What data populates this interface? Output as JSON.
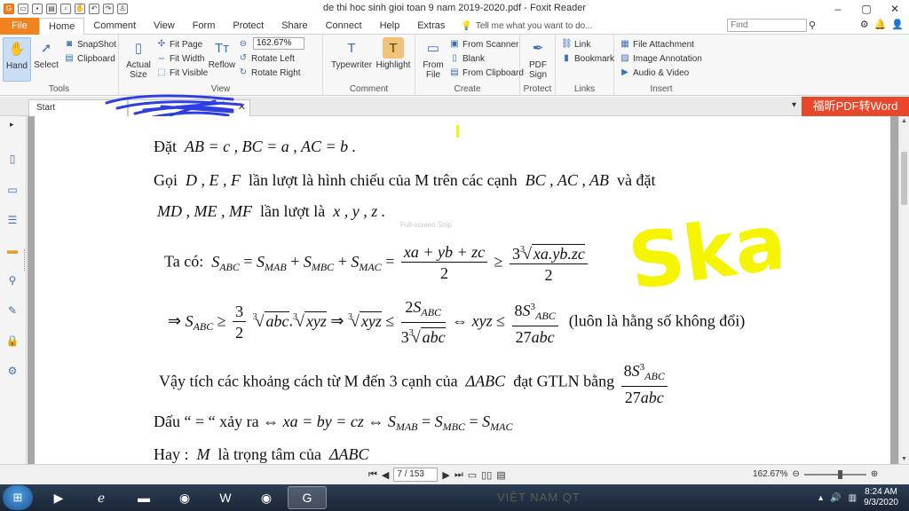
{
  "window": {
    "title": "de thi hoc sinh gioi toan 9 nam 2019-2020.pdf - Foxit Reader"
  },
  "tabs": {
    "file": "File",
    "items": [
      "Home",
      "Comment",
      "View",
      "Form",
      "Protect",
      "Share",
      "Connect",
      "Help",
      "Extras"
    ],
    "tell_me": "Tell me what you want to do...",
    "find_placeholder": "Find"
  },
  "ribbon": {
    "tools": {
      "hand": "Hand",
      "select": "Select",
      "snapshot": "SnapShot",
      "clipboard": "Clipboard",
      "label": "Tools"
    },
    "view": {
      "actual_size_1": "Actual",
      "actual_size_2": "Size",
      "fit_page": "Fit Page",
      "fit_width": "Fit Width",
      "fit_visible": "Fit Visible",
      "reflow": "Reflow",
      "zoom": "162.67%",
      "rotate_left": "Rotate Left",
      "rotate_right": "Rotate Right",
      "label": "View"
    },
    "comment": {
      "typewriter": "Typewriter",
      "highlight": "Highlight",
      "label": "Comment"
    },
    "create": {
      "from_file_1": "From",
      "from_file_2": "File",
      "from_scanner": "From Scanner",
      "blank": "Blank",
      "from_clipboard": "From Clipboard",
      "label": "Create"
    },
    "protect": {
      "pdf_sign_1": "PDF",
      "pdf_sign_2": "Sign",
      "label": "Protect"
    },
    "links": {
      "link": "Link",
      "bookmark": "Bookmark",
      "label": "Links"
    },
    "insert": {
      "file_attachment": "File Attachment",
      "image_annotation": "Image Annotation",
      "audio_video": "Audio & Video",
      "label": "Insert"
    }
  },
  "doc_tabs": {
    "start": "Start",
    "promo": "福昕PDF转Word"
  },
  "document": {
    "l1_a": "Đặt",
    "l1_b": "AB = c , BC = a ,  AC = b  .",
    "l2_a": "Gọi",
    "l2_b": "D , E , F",
    "l2_c": "lần lượt là hình chiếu của M trên các cạnh",
    "l2_d": "BC , AC , AB",
    "l2_e": "và đặt",
    "l3_a": "MD , ME , MF",
    "l3_b": "lần lượt là",
    "l3_c": "x , y , z  .",
    "ghost": "Full-screen Snip",
    "l4_a": "Ta có:",
    "l5_note": "(luôn là hằng số không đổi)",
    "l6_text": "Vậy tích các khoảng cách từ M đến 3 cạnh của",
    "l6_b": "ΔABC",
    "l6_c": "đạt GTLN bằng",
    "l7_a": "Dấu “ = “ xảy ra",
    "l8_a": "Hay :",
    "l8_b": "M",
    "l8_c": "là trọng tâm của",
    "l8_d": "ΔABC",
    "annotation": "Skai"
  },
  "statusbar": {
    "page": "7 / 153",
    "zoom": "162.67%"
  },
  "taskbar": {
    "time": "8:24 AM",
    "date": "9/3/2020",
    "bg_text": "VIỆT NAM QT"
  },
  "colors": {
    "accent": "#f0821f",
    "promo": "#e8472b",
    "annotation_yellow": "#f5f500",
    "scribble_blue": "#2f3ee0"
  }
}
